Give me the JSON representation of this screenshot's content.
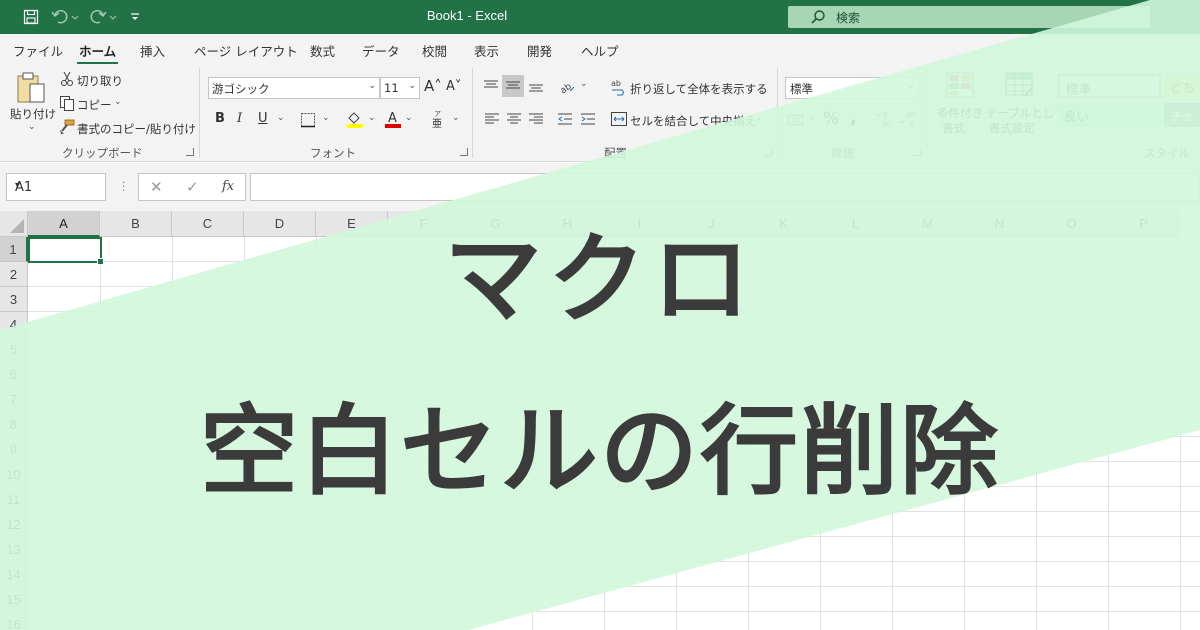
{
  "titlebar": {
    "title": "Book1  -  Excel",
    "search_placeholder": "検索",
    "icons": [
      "save-icon",
      "undo-icon",
      "redo-icon",
      "customize-qat-icon"
    ]
  },
  "tabs": [
    {
      "label": "ファイル",
      "active": false
    },
    {
      "label": "ホーム",
      "active": true
    },
    {
      "label": "挿入",
      "active": false
    },
    {
      "label": "ページ レイアウト",
      "active": false
    },
    {
      "label": "数式",
      "active": false
    },
    {
      "label": "データ",
      "active": false
    },
    {
      "label": "校閲",
      "active": false
    },
    {
      "label": "表示",
      "active": false
    },
    {
      "label": "開発",
      "active": false
    },
    {
      "label": "ヘルプ",
      "active": false
    }
  ],
  "ribbon": {
    "clipboard": {
      "paste": "貼り付け",
      "cut": "切り取り",
      "copy": "コピー",
      "format_painter": "書式のコピー/貼り付け",
      "group": "クリップボード"
    },
    "font": {
      "font_name": "游ゴシック",
      "font_size": "11",
      "bold": "B",
      "italic": "I",
      "underline": "U",
      "group": "フォント"
    },
    "alignment": {
      "wrap_text": "折り返して全体を表示する",
      "merge_center": "セルを結合して中央揃え",
      "group": "配置"
    },
    "number": {
      "format": "標準",
      "group": "数値"
    },
    "styles": {
      "conditional": [
        "条件付き",
        "書式"
      ],
      "table": [
        "テーブルとして",
        "書式設定"
      ],
      "cell_normal": "標準",
      "cell_neutral": "どち",
      "cell_good": "良い",
      "cell_check": "チェ",
      "group": "スタイル"
    }
  },
  "formula_bar": {
    "name_box": "A1",
    "fx": "fx",
    "value": ""
  },
  "grid": {
    "columns": [
      "A",
      "B",
      "C",
      "D",
      "E",
      "F",
      "G",
      "H",
      "I",
      "J",
      "K",
      "L",
      "M",
      "N",
      "O",
      "P"
    ],
    "rows": [
      "1",
      "2",
      "3",
      "4",
      "5",
      "6",
      "7",
      "8",
      "9",
      "10",
      "11",
      "12",
      "13",
      "14",
      "15",
      "16"
    ],
    "active_cell": "A1"
  },
  "overlay": {
    "line1": "マクロ",
    "line2": "空白セルの行削除",
    "band_color": "#d2f7db"
  },
  "colors": {
    "accent": "#217346",
    "headline": "#3b3b3b"
  }
}
